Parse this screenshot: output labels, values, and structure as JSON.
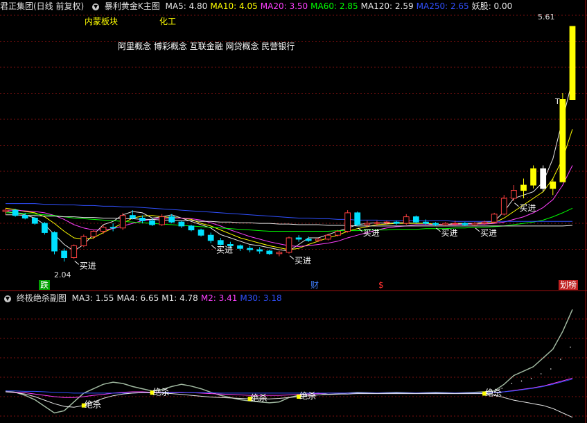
{
  "header": {
    "stock_title": "君正集团(日线 前复权)",
    "indicator_name": "暴利黄金K主图",
    "ma_items": [
      {
        "label": "MA5: 4.80",
        "color": "#e8e8e8"
      },
      {
        "label": "MA10: 4.05",
        "color": "#ffff00"
      },
      {
        "label": "MA20: 3.50",
        "color": "#ff40ff"
      },
      {
        "label": "MA60: 2.85",
        "color": "#00ff00"
      },
      {
        "label": "MA120: 2.59",
        "color": "#e8e8e8"
      },
      {
        "label": "MA250: 2.65",
        "color": "#3050ff"
      },
      {
        "label": "妖股: 0.00",
        "color": "#e8e8e8"
      }
    ]
  },
  "annotations": {
    "sector": "内蒙板块",
    "industry": "化工",
    "concepts": "阿里概念 博彩概念 互联金融 网贷概念 民营银行",
    "high_price": "5.61",
    "low_price": "2.04",
    "t_mark": "T",
    "buy_label": "买进",
    "bottom_marks": [
      {
        "text": "跌",
        "bg": "#00a000",
        "color": "#fff"
      },
      {
        "text": "财",
        "bg": "#000",
        "color": "#4080ff"
      },
      {
        "text": "$",
        "bg": "#000",
        "color": "#ff3030"
      },
      {
        "text": "划榜",
        "bg": "#c02020",
        "color": "#fff"
      }
    ]
  },
  "sub_header": {
    "indicator_name": "终极绝杀副图",
    "items": [
      {
        "label": "MA3: 1.55",
        "color": "#e8e8e8"
      },
      {
        "label": "MA4: 6.65",
        "color": "#e8e8e8"
      },
      {
        "label": "M1: 4.78",
        "color": "#e8e8e8"
      },
      {
        "label": "M2: 3.41",
        "color": "#ff40ff"
      },
      {
        "label": "M30: 3.18",
        "color": "#3050ff"
      }
    ]
  },
  "sub_annotations": {
    "kill_label": "绝杀"
  },
  "chart_data": [
    {
      "type": "line",
      "title": "",
      "note": "Main candlestick price chart with moving averages",
      "ylim": [
        1.8,
        5.8
      ],
      "highlighted_values": {
        "high": 5.61,
        "low": 2.04
      },
      "series": [
        {
          "name": "MA5",
          "color": "#e8e8e8",
          "values": [
            2.8,
            2.78,
            2.75,
            2.7,
            2.6,
            2.45,
            2.3,
            2.2,
            2.3,
            2.45,
            2.6,
            2.65,
            2.75,
            2.8,
            2.78,
            2.7,
            2.72,
            2.75,
            2.7,
            2.65,
            2.6,
            2.55,
            2.45,
            2.4,
            2.35,
            2.3,
            2.28,
            2.25,
            2.22,
            2.2,
            2.3,
            2.4,
            2.4,
            2.45,
            2.5,
            2.55,
            2.6,
            2.62,
            2.63,
            2.62,
            2.63,
            2.63,
            2.62,
            2.62,
            2.6,
            2.6,
            2.62,
            2.62,
            2.62,
            2.64,
            2.65,
            2.8,
            3.0,
            3.05,
            3.1,
            3.25,
            3.6,
            4.2,
            4.8
          ]
        },
        {
          "name": "MA10",
          "color": "#ffff00",
          "values": [
            2.85,
            2.83,
            2.8,
            2.78,
            2.72,
            2.62,
            2.5,
            2.4,
            2.38,
            2.4,
            2.48,
            2.55,
            2.62,
            2.7,
            2.73,
            2.74,
            2.72,
            2.71,
            2.7,
            2.68,
            2.62,
            2.58,
            2.52,
            2.46,
            2.4,
            2.36,
            2.32,
            2.28,
            2.25,
            2.22,
            2.24,
            2.3,
            2.35,
            2.4,
            2.44,
            2.5,
            2.54,
            2.57,
            2.6,
            2.61,
            2.62,
            2.62,
            2.62,
            2.62,
            2.61,
            2.6,
            2.61,
            2.61,
            2.61,
            2.62,
            2.63,
            2.7,
            2.8,
            2.9,
            3.0,
            3.1,
            3.3,
            3.6,
            4.05
          ]
        },
        {
          "name": "MA20",
          "color": "#ff40ff",
          "values": [
            2.82,
            2.82,
            2.81,
            2.8,
            2.78,
            2.74,
            2.68,
            2.6,
            2.55,
            2.52,
            2.52,
            2.54,
            2.58,
            2.62,
            2.66,
            2.68,
            2.7,
            2.7,
            2.7,
            2.69,
            2.67,
            2.63,
            2.58,
            2.52,
            2.47,
            2.42,
            2.38,
            2.34,
            2.31,
            2.28,
            2.27,
            2.28,
            2.3,
            2.32,
            2.35,
            2.4,
            2.44,
            2.48,
            2.52,
            2.55,
            2.57,
            2.58,
            2.6,
            2.6,
            2.6,
            2.6,
            2.6,
            2.61,
            2.61,
            2.61,
            2.62,
            2.64,
            2.68,
            2.72,
            2.78,
            2.86,
            2.98,
            3.2,
            3.5
          ]
        },
        {
          "name": "MA60",
          "color": "#00ff00",
          "values": [
            2.78,
            2.78,
            2.77,
            2.76,
            2.75,
            2.74,
            2.72,
            2.7,
            2.69,
            2.68,
            2.67,
            2.66,
            2.65,
            2.64,
            2.63,
            2.62,
            2.61,
            2.6,
            2.59,
            2.58,
            2.57,
            2.56,
            2.55,
            2.54,
            2.53,
            2.52,
            2.51,
            2.5,
            2.5,
            2.5,
            2.5,
            2.5,
            2.5,
            2.5,
            2.51,
            2.51,
            2.51,
            2.52,
            2.52,
            2.52,
            2.53,
            2.53,
            2.53,
            2.54,
            2.54,
            2.54,
            2.55,
            2.55,
            2.56,
            2.56,
            2.57,
            2.58,
            2.6,
            2.62,
            2.64,
            2.67,
            2.72,
            2.78,
            2.85
          ]
        },
        {
          "name": "MA120",
          "color": "#e8e8e8",
          "values": [
            2.75,
            2.75,
            2.74,
            2.74,
            2.73,
            2.73,
            2.72,
            2.72,
            2.71,
            2.71,
            2.7,
            2.7,
            2.69,
            2.69,
            2.68,
            2.68,
            2.67,
            2.67,
            2.66,
            2.66,
            2.65,
            2.65,
            2.64,
            2.64,
            2.63,
            2.63,
            2.62,
            2.62,
            2.61,
            2.61,
            2.6,
            2.6,
            2.6,
            2.59,
            2.59,
            2.59,
            2.58,
            2.58,
            2.58,
            2.58,
            2.58,
            2.58,
            2.58,
            2.58,
            2.58,
            2.58,
            2.58,
            2.58,
            2.58,
            2.58,
            2.58,
            2.58,
            2.58,
            2.58,
            2.58,
            2.58,
            2.58,
            2.58,
            2.59
          ]
        },
        {
          "name": "MA250",
          "color": "#3050ff",
          "values": [
            2.92,
            2.92,
            2.92,
            2.92,
            2.91,
            2.91,
            2.9,
            2.9,
            2.89,
            2.89,
            2.88,
            2.88,
            2.87,
            2.87,
            2.86,
            2.85,
            2.84,
            2.83,
            2.82,
            2.81,
            2.8,
            2.79,
            2.78,
            2.77,
            2.76,
            2.75,
            2.74,
            2.73,
            2.72,
            2.71,
            2.7,
            2.7,
            2.69,
            2.69,
            2.68,
            2.68,
            2.67,
            2.67,
            2.67,
            2.66,
            2.66,
            2.66,
            2.66,
            2.66,
            2.66,
            2.66,
            2.65,
            2.65,
            2.65,
            2.65,
            2.65,
            2.65,
            2.65,
            2.65,
            2.65,
            2.65,
            2.65,
            2.65,
            2.65
          ]
        }
      ],
      "candles": [
        [
          2.8,
          2.85,
          2.75,
          2.82
        ],
        [
          2.82,
          2.84,
          2.72,
          2.74
        ],
        [
          2.74,
          2.78,
          2.68,
          2.7
        ],
        [
          2.7,
          2.72,
          2.6,
          2.62
        ],
        [
          2.62,
          2.64,
          2.45,
          2.48
        ],
        [
          2.48,
          2.5,
          2.15,
          2.2
        ],
        [
          2.2,
          2.24,
          2.04,
          2.1
        ],
        [
          2.1,
          2.3,
          2.08,
          2.28
        ],
        [
          2.28,
          2.45,
          2.26,
          2.42
        ],
        [
          2.42,
          2.52,
          2.38,
          2.5
        ],
        [
          2.5,
          2.6,
          2.46,
          2.56
        ],
        [
          2.56,
          2.62,
          2.5,
          2.55
        ],
        [
          2.55,
          2.78,
          2.52,
          2.74
        ],
        [
          2.74,
          2.82,
          2.68,
          2.7
        ],
        [
          2.7,
          2.74,
          2.62,
          2.66
        ],
        [
          2.66,
          2.7,
          2.58,
          2.6
        ],
        [
          2.6,
          2.76,
          2.58,
          2.72
        ],
        [
          2.72,
          2.76,
          2.62,
          2.64
        ],
        [
          2.64,
          2.66,
          2.55,
          2.58
        ],
        [
          2.58,
          2.6,
          2.5,
          2.52
        ],
        [
          2.52,
          2.54,
          2.42,
          2.44
        ],
        [
          2.44,
          2.48,
          2.32,
          2.36
        ],
        [
          2.36,
          2.4,
          2.28,
          2.3
        ],
        [
          2.3,
          2.34,
          2.24,
          2.28
        ],
        [
          2.28,
          2.3,
          2.2,
          2.24
        ],
        [
          2.24,
          2.28,
          2.18,
          2.22
        ],
        [
          2.22,
          2.26,
          2.16,
          2.2
        ],
        [
          2.2,
          2.22,
          2.14,
          2.16
        ],
        [
          2.16,
          2.2,
          2.12,
          2.18
        ],
        [
          2.18,
          2.42,
          2.16,
          2.4
        ],
        [
          2.4,
          2.44,
          2.34,
          2.38
        ],
        [
          2.38,
          2.42,
          2.34,
          2.36
        ],
        [
          2.36,
          2.4,
          2.34,
          2.38
        ],
        [
          2.38,
          2.46,
          2.36,
          2.44
        ],
        [
          2.44,
          2.52,
          2.42,
          2.5
        ],
        [
          2.5,
          2.82,
          2.48,
          2.78
        ],
        [
          2.78,
          2.8,
          2.58,
          2.6
        ],
        [
          2.6,
          2.66,
          2.56,
          2.62
        ],
        [
          2.62,
          2.66,
          2.58,
          2.63
        ],
        [
          2.63,
          2.66,
          2.6,
          2.64
        ],
        [
          2.64,
          2.66,
          2.6,
          2.62
        ],
        [
          2.62,
          2.76,
          2.6,
          2.72
        ],
        [
          2.72,
          2.74,
          2.62,
          2.64
        ],
        [
          2.64,
          2.68,
          2.6,
          2.62
        ],
        [
          2.62,
          2.64,
          2.58,
          2.6
        ],
        [
          2.6,
          2.64,
          2.58,
          2.62
        ],
        [
          2.62,
          2.66,
          2.58,
          2.62
        ],
        [
          2.62,
          2.64,
          2.58,
          2.6
        ],
        [
          2.6,
          2.64,
          2.58,
          2.62
        ],
        [
          2.62,
          2.66,
          2.6,
          2.64
        ],
        [
          2.64,
          2.78,
          2.62,
          2.76
        ],
        [
          2.76,
          3.05,
          2.74,
          3.0
        ],
        [
          3.0,
          3.2,
          2.96,
          3.12
        ],
        [
          3.12,
          3.3,
          3.0,
          3.2
        ],
        [
          3.2,
          3.5,
          3.15,
          3.45
        ],
        [
          3.45,
          3.5,
          3.1,
          3.15
        ],
        [
          3.15,
          3.3,
          3.05,
          3.25
        ],
        [
          3.25,
          4.6,
          3.25,
          4.5
        ],
        [
          4.5,
          5.61,
          4.5,
          5.61
        ]
      ],
      "buy_signals_index": [
        7,
        21,
        29,
        36,
        44,
        48,
        52
      ]
    },
    {
      "type": "line",
      "title": "",
      "note": "Sub indicator oscillator",
      "ylim": [
        -6,
        20
      ],
      "series": [
        {
          "name": "MA3",
          "color": "#a0b8a0",
          "values": [
            0.5,
            0.2,
            -0.5,
            -1.5,
            -3,
            -4.5,
            -4,
            -2,
            0,
            1,
            2,
            2.5,
            2.2,
            1.5,
            1,
            0.5,
            0.8,
            1.5,
            2,
            1.6,
            1,
            0.2,
            -0.5,
            -1,
            -1.5,
            -1.8,
            -2,
            -2.2,
            -2,
            -1,
            -0.5,
            -0.2,
            0,
            -0.3,
            -0.2,
            0,
            0.2,
            0.1,
            0,
            0.1,
            0.2,
            0.1,
            0,
            0.1,
            0.2,
            0.1,
            0,
            0.1,
            0.2,
            0.3,
            0.5,
            2,
            4,
            5,
            6,
            8,
            10,
            14,
            19
          ]
        },
        {
          "name": "M2",
          "color": "#ff40ff",
          "values": [
            0.3,
            0.2,
            0.1,
            -0.2,
            -0.5,
            -0.8,
            -1,
            -1,
            -0.8,
            -0.5,
            -0.3,
            0,
            0.2,
            0.3,
            0.3,
            0.2,
            0.2,
            0.2,
            0.2,
            0.1,
            0,
            -0.1,
            -0.2,
            -0.3,
            -0.4,
            -0.5,
            -0.5,
            -0.5,
            -0.5,
            -0.4,
            -0.3,
            -0.2,
            -0.1,
            0,
            0,
            0,
            0,
            0,
            0,
            0,
            0,
            0,
            0,
            0,
            0,
            0,
            0,
            0,
            0,
            0,
            0.1,
            0.3,
            0.6,
            0.9,
            1.2,
            1.6,
            2.2,
            2.8,
            3.41
          ]
        },
        {
          "name": "M30",
          "color": "#3050ff",
          "values": [
            0.5,
            0.5,
            0.4,
            0.4,
            0.3,
            0.2,
            0.1,
            0,
            0,
            0,
            0,
            0,
            0,
            0,
            0.1,
            0.1,
            0.1,
            0.1,
            0.1,
            0.1,
            0.1,
            0.1,
            0,
            0,
            0,
            0,
            0,
            0,
            0,
            0,
            0,
            0,
            0,
            0,
            0,
            0,
            0,
            0,
            0,
            0,
            0,
            0,
            0,
            0,
            0,
            0,
            0,
            0,
            0,
            0,
            0.1,
            0.3,
            0.5,
            0.8,
            1.1,
            1.5,
            2,
            2.6,
            3.18
          ]
        },
        {
          "name": "M1",
          "color": "#e8e8e8",
          "values": [
            0.3,
            0.1,
            -0.2,
            -0.8,
            -1.6,
            -2.4,
            -3,
            -3.2,
            -2.8,
            -2,
            -1.2,
            -0.6,
            -0.2,
            0,
            0.1,
            0.1,
            0,
            -0.1,
            -0.3,
            -0.5,
            -0.7,
            -0.9,
            -1,
            -1.1,
            -1.2,
            -1.3,
            -1.3,
            -1.3,
            -1.2,
            -1,
            -0.8,
            -0.6,
            -0.4,
            -0.3,
            -0.2,
            -0.2,
            -0.1,
            -0.1,
            -0.1,
            -0.1,
            -0.1,
            -0.1,
            -0.1,
            -0.1,
            -0.1,
            -0.1,
            -0.1,
            -0.1,
            -0.1,
            -0.1,
            -0.4,
            -1,
            -1.6,
            -2,
            -2.4,
            -2.8,
            -3.5,
            -4.5,
            -5.5
          ]
        }
      ],
      "kill_signals_index": [
        8,
        15,
        25,
        30,
        49
      ]
    }
  ]
}
